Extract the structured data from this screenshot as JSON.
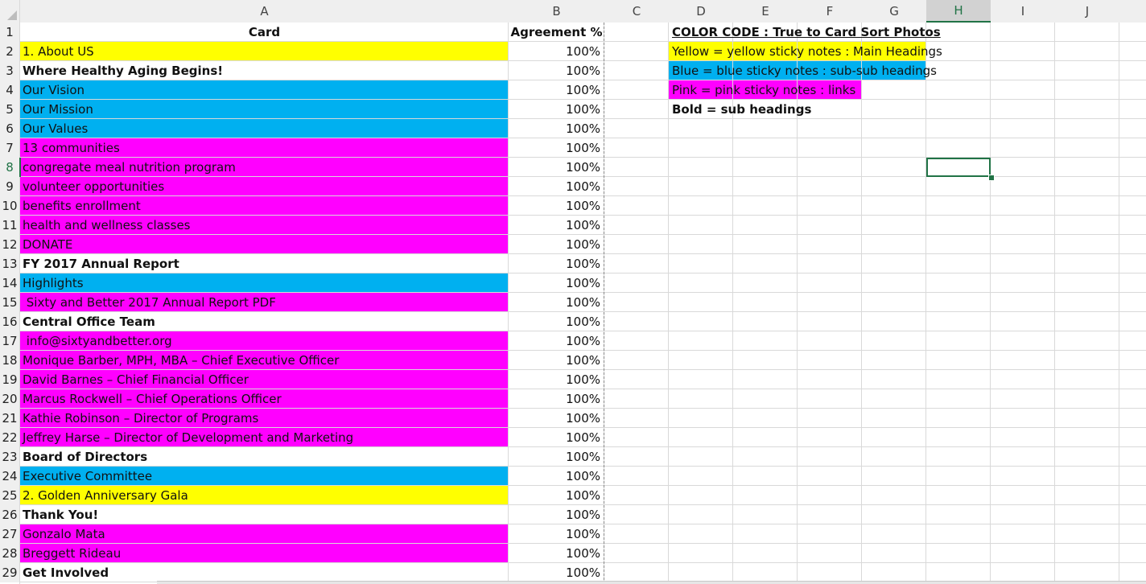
{
  "column_headers": [
    "A",
    "B",
    "C",
    "D",
    "E",
    "F",
    "G",
    "H",
    "I",
    "J"
  ],
  "selected_column": "H",
  "colors": {
    "yellow": "#ffff00",
    "blue": "#00b0f0",
    "pink": "#ff00ff",
    "header_bg": "#efefef",
    "grid": "#d9d9d9",
    "selection": "#217346"
  },
  "header_row": {
    "card": "Card",
    "agreement": "Agreement %"
  },
  "rows": [
    {
      "n": "2",
      "card": "1. About US",
      "agreement": "100%",
      "fill": "yellow",
      "bold": false
    },
    {
      "n": "3",
      "card": "Where Healthy Aging Begins!",
      "agreement": "100%",
      "fill": "none",
      "bold": true
    },
    {
      "n": "4",
      "card": "Our Vision",
      "agreement": "100%",
      "fill": "blue",
      "bold": false
    },
    {
      "n": "5",
      "card": "Our Mission",
      "agreement": "100%",
      "fill": "blue",
      "bold": false
    },
    {
      "n": "6",
      "card": "Our Values",
      "agreement": "100%",
      "fill": "blue",
      "bold": false
    },
    {
      "n": "7",
      "card": "13 communities",
      "agreement": "100%",
      "fill": "pink",
      "bold": false
    },
    {
      "n": "8",
      "card": "congregate meal nutrition program",
      "agreement": "100%",
      "fill": "pink",
      "bold": false
    },
    {
      "n": "9",
      "card": "volunteer opportunities",
      "agreement": "100%",
      "fill": "pink",
      "bold": false
    },
    {
      "n": "10",
      "card": "benefits enrollment",
      "agreement": "100%",
      "fill": "pink",
      "bold": false
    },
    {
      "n": "11",
      "card": "health and wellness classes",
      "agreement": "100%",
      "fill": "pink",
      "bold": false
    },
    {
      "n": "12",
      "card": "DONATE",
      "agreement": "100%",
      "fill": "pink",
      "bold": false
    },
    {
      "n": "13",
      "card": "FY 2017 Annual Report",
      "agreement": "100%",
      "fill": "none",
      "bold": true
    },
    {
      "n": "14",
      "card": "Highlights",
      "agreement": "100%",
      "fill": "blue",
      "bold": false
    },
    {
      "n": "15",
      "card": " Sixty and Better 2017 Annual Report PDF",
      "agreement": "100%",
      "fill": "pink",
      "bold": false
    },
    {
      "n": "16",
      "card": "Central Office Team",
      "agreement": "100%",
      "fill": "none",
      "bold": true
    },
    {
      "n": "17",
      "card": " info@sixtyandbetter.org",
      "agreement": "100%",
      "fill": "pink",
      "bold": false
    },
    {
      "n": "18",
      "card": "Monique Barber, MPH, MBA – Chief Executive Officer",
      "agreement": "100%",
      "fill": "pink",
      "bold": false
    },
    {
      "n": "19",
      "card": "David Barnes – Chief Financial Officer",
      "agreement": "100%",
      "fill": "pink",
      "bold": false
    },
    {
      "n": "20",
      "card": "Marcus Rockwell – Chief Operations Officer",
      "agreement": "100%",
      "fill": "pink",
      "bold": false
    },
    {
      "n": "21",
      "card": "Kathie Robinson – Director of Programs",
      "agreement": "100%",
      "fill": "pink",
      "bold": false
    },
    {
      "n": "22",
      "card": "Jeffrey Harse – Director of Development and Marketing",
      "agreement": "100%",
      "fill": "pink",
      "bold": false
    },
    {
      "n": "23",
      "card": "Board of Directors",
      "agreement": "100%",
      "fill": "none",
      "bold": true
    },
    {
      "n": "24",
      "card": "Executive Committee",
      "agreement": "100%",
      "fill": "blue",
      "bold": false
    },
    {
      "n": "25",
      "card": "2. Golden Anniversary Gala",
      "agreement": "100%",
      "fill": "yellow",
      "bold": false
    },
    {
      "n": "26",
      "card": "Thank You!",
      "agreement": "100%",
      "fill": "none",
      "bold": true
    },
    {
      "n": "27",
      "card": "Gonzalo Mata",
      "agreement": "100%",
      "fill": "pink",
      "bold": false
    },
    {
      "n": "28",
      "card": "Breggett Rideau",
      "agreement": "100%",
      "fill": "pink",
      "bold": false
    },
    {
      "n": "29",
      "card": "Get Involved",
      "agreement": "100%",
      "fill": "none",
      "bold": true
    }
  ],
  "legend": {
    "title": "COLOR CODE : True to Card Sort Photos",
    "yellow": "Yellow = yellow sticky notes : Main Headings",
    "blue": "Blue = blue sticky notes : sub-sub headings",
    "pink": "Pink = pink sticky notes : links",
    "bold": "Bold = sub headings"
  }
}
